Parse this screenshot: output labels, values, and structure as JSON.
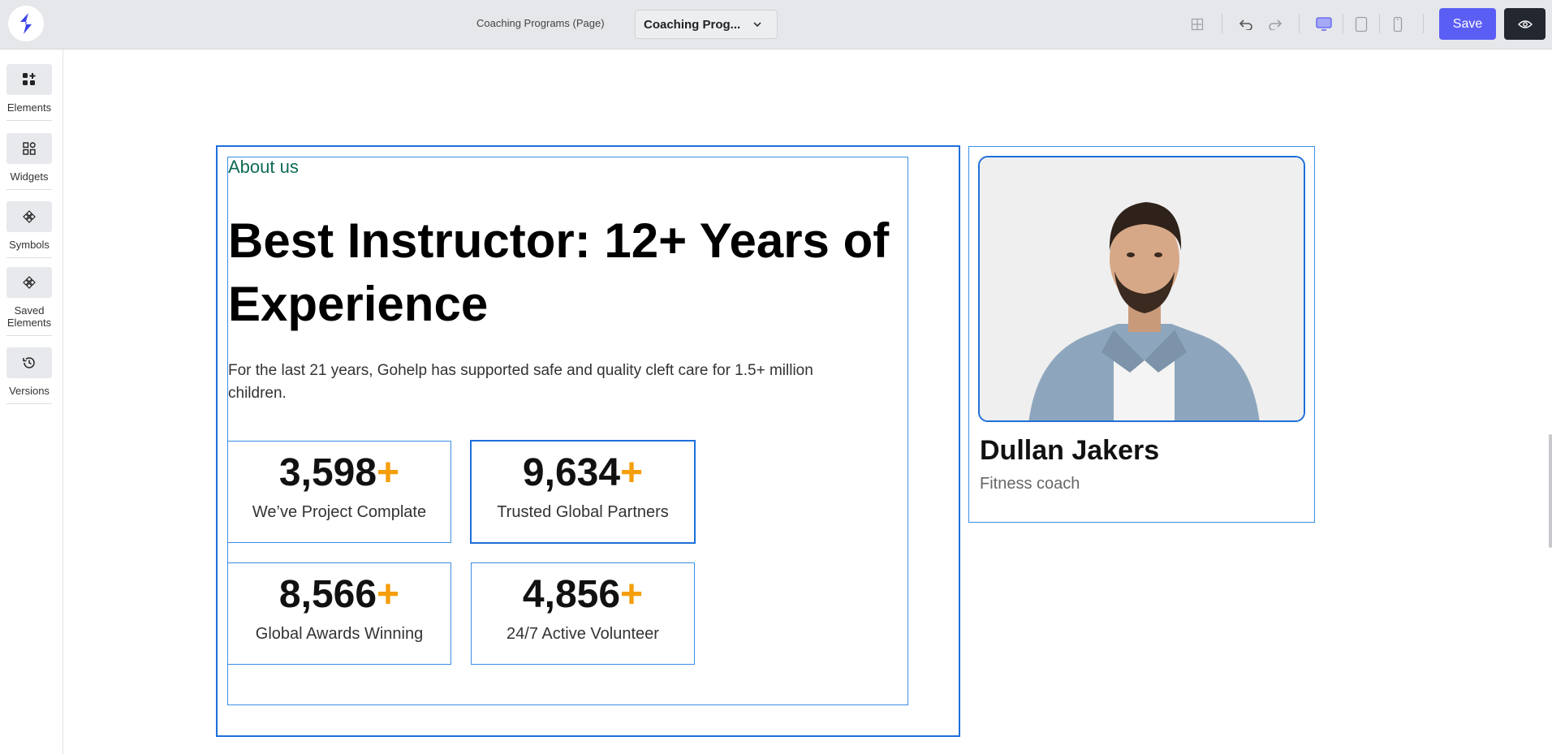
{
  "topbar": {
    "page_label": "Coaching Programs (Page)",
    "page_select_value": "Coaching Prog...",
    "save_label": "Save"
  },
  "sidebar": {
    "items": [
      {
        "label": "Elements",
        "icon": "elements-plus-icon"
      },
      {
        "label": "Widgets",
        "icon": "widgets-grid-icon"
      },
      {
        "label": "Symbols",
        "icon": "symbols-diamond-icon"
      },
      {
        "label": "Saved Elements",
        "icon": "saved-elements-diamond-icon"
      },
      {
        "label": "Versions",
        "icon": "history-clock-icon"
      }
    ]
  },
  "about": {
    "subtitle": "About us",
    "headline": "Best Instructor: 12+ Years of Experience",
    "description": "For the last 21 years, Gohelp has supported safe and quality cleft care for 1.5+ million children.",
    "stats": [
      {
        "number": "3,598",
        "suffix": "+",
        "label": "We’ve Project Complate"
      },
      {
        "number": "9,634",
        "suffix": "+",
        "label": "Trusted Global Partners"
      },
      {
        "number": "8,566",
        "suffix": "+",
        "label": "Global Awards Winning"
      },
      {
        "number": "4,856",
        "suffix": "+",
        "label": "24/7 Active Volunteer"
      }
    ]
  },
  "profile": {
    "name": "Dullan Jakers",
    "role": "Fitness coach"
  },
  "colors": {
    "accent": "#5b5ef4",
    "selection": "#1e6fd9",
    "plus": "#f59e0b",
    "subtitle": "#0f6b56"
  }
}
